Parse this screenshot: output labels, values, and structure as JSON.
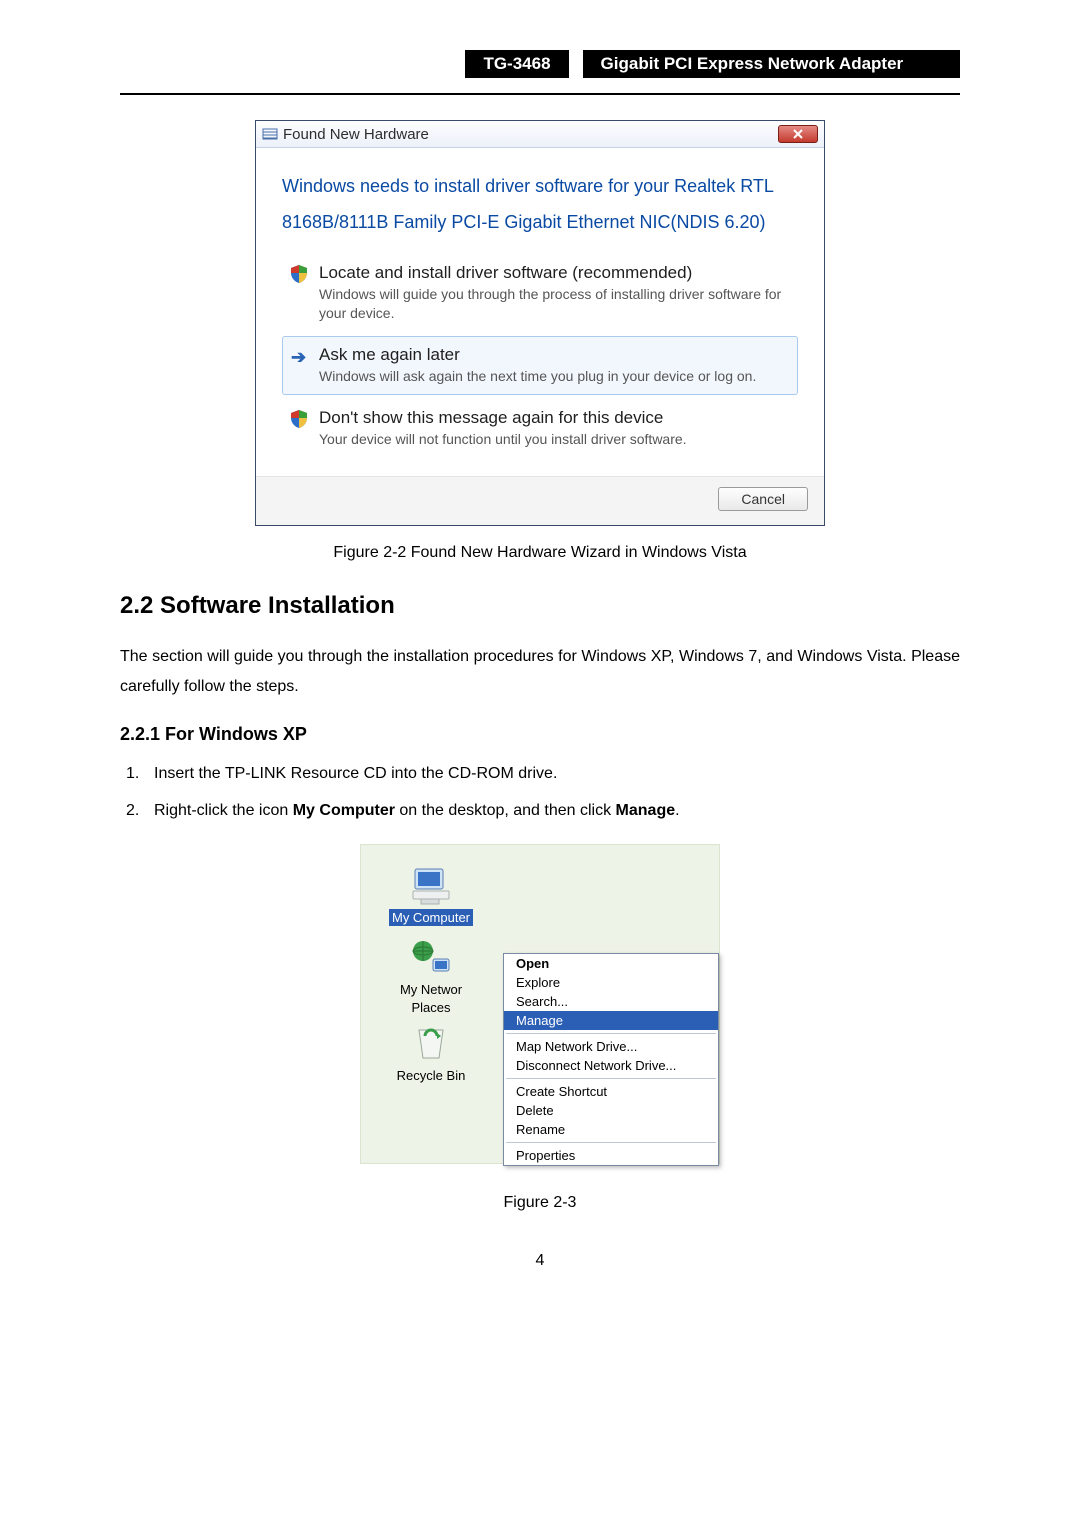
{
  "header": {
    "model": "TG-3468",
    "title": "Gigabit PCI Express Network Adapter"
  },
  "dialog": {
    "title": "Found New Hardware",
    "need_line1": "Windows needs to install driver software for your Realtek RTL",
    "need_line2": "8168B/8111B Family PCI-E Gigabit Ethernet NIC(NDIS 6.20)",
    "opt1_title": "Locate and install driver software (recommended)",
    "opt1_desc": "Windows will guide you through the process of installing driver software for your device.",
    "opt2_title": "Ask me again later",
    "opt2_desc": "Windows will ask again the next time you plug in your device or log on.",
    "opt3_title": "Don't show this message again for this device",
    "opt3_desc": "Your device will not function until you install driver software.",
    "cancel": "Cancel"
  },
  "fig22": "Figure 2-2 Found New Hardware Wizard in Windows Vista",
  "sec22": "2.2   Software Installation",
  "para22": "The section will guide you through the installation procedures for Windows XP, Windows 7, and Windows Vista. Please carefully follow the steps.",
  "sec221": "2.2.1  For Windows XP",
  "steps": {
    "s1": {
      "num": "1.",
      "text": "Insert the TP-LINK Resource CD into the CD-ROM drive."
    },
    "s2": {
      "num": "2.",
      "pre": "Right-click the icon ",
      "b1": "My Computer",
      "mid": " on the desktop, and then click ",
      "b2": "Manage",
      "post": "."
    }
  },
  "desk": {
    "my_computer": "My Computer",
    "my_network": "My Network Places",
    "recycle": "Recycle Bin"
  },
  "ctx": {
    "open": "Open",
    "explore": "Explore",
    "search": "Search...",
    "manage": "Manage",
    "map": "Map Network Drive...",
    "disc": "Disconnect Network Drive...",
    "shortcut": "Create Shortcut",
    "delete": "Delete",
    "rename": "Rename",
    "props": "Properties"
  },
  "fig23": "Figure 2-3",
  "page": "4"
}
